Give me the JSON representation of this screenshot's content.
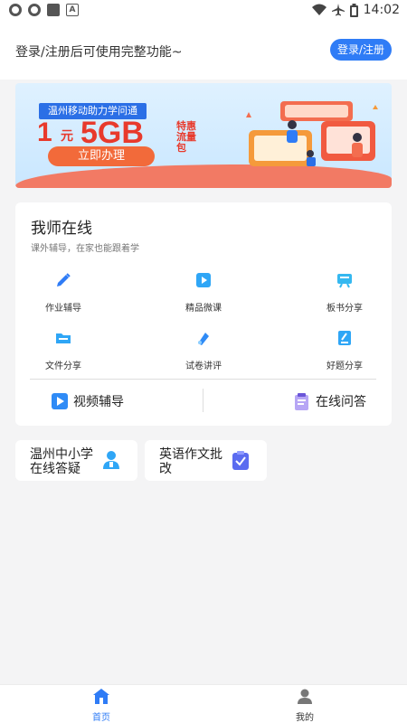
{
  "status_bar": {
    "time": "14:02",
    "icons": [
      "sync-icon",
      "sync-icon",
      "square-icon",
      "a-icon",
      "wifi-icon",
      "airplane-icon",
      "battery-icon"
    ]
  },
  "header": {
    "login_tip": "登录/注册后可使用完整功能~",
    "login_button": "登录/注册"
  },
  "banner": {
    "tag": "温州移动助力学问通",
    "amount": "1",
    "unit": "元",
    "data": "5GB",
    "extra": "特惠流量包",
    "cta": "立即办理"
  },
  "teacher_card": {
    "title": "我师在线",
    "subtitle": "课外辅导，在家也能跟着学",
    "grid": [
      {
        "label": "作业辅导",
        "icon": "pencil-icon",
        "color": "#2f7cf6"
      },
      {
        "label": "精品微课",
        "icon": "play-icon",
        "color": "#2fa6f6"
      },
      {
        "label": "板书分享",
        "icon": "board-icon",
        "color": "#35b8f0"
      },
      {
        "label": "文件分享",
        "icon": "folder-icon",
        "color": "#2fa6f6"
      },
      {
        "label": "试卷讲评",
        "icon": "paper-icon",
        "color": "#2f8bf6"
      },
      {
        "label": "好题分享",
        "icon": "doc-edit-icon",
        "color": "#2fa6f6"
      }
    ],
    "actions": [
      {
        "label": "视频辅导",
        "icon": "video-icon"
      },
      {
        "label": "在线问答",
        "icon": "qa-icon"
      }
    ]
  },
  "shortcuts": [
    {
      "label": "温州中小学在线答疑",
      "icon": "teacher-icon",
      "color": "#2fa6f6"
    },
    {
      "label": "英语作文批改",
      "icon": "clipboard-check-icon",
      "color": "#5b6cf0"
    }
  ],
  "tabbar": {
    "items": [
      {
        "label": "首页",
        "icon": "home-icon",
        "active": true
      },
      {
        "label": "我的",
        "icon": "user-icon",
        "active": false
      }
    ],
    "active_color": "#2f7cf6",
    "inactive_color": "#333333"
  }
}
